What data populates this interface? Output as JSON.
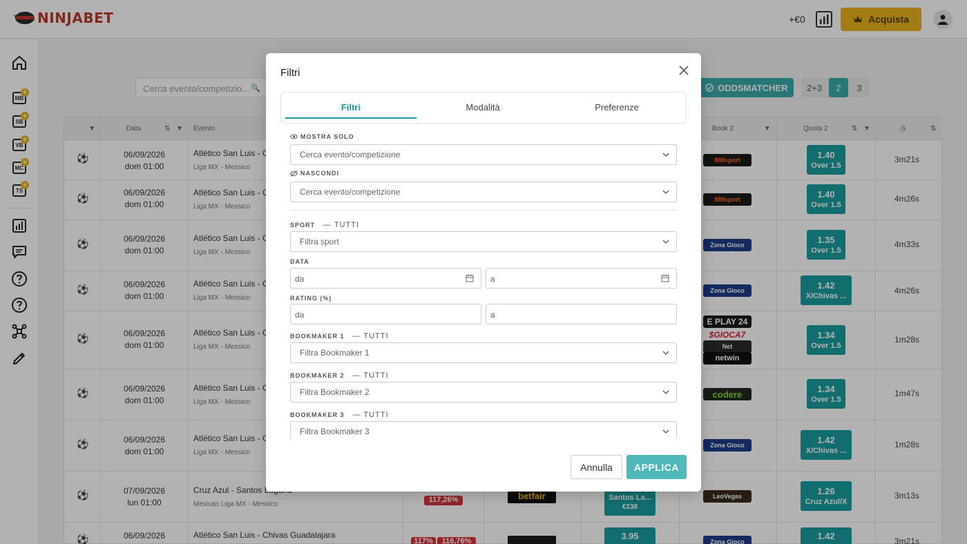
{
  "app": {
    "logo_text": "NINJABET"
  },
  "header": {
    "balance": "+€0",
    "buy_label": "Acquista"
  },
  "sidebar": {
    "tags": [
      "MB",
      "SB",
      "VB",
      "MC",
      "TS"
    ]
  },
  "toolbar": {
    "search_placeholder": "Cerca evento/competizio...",
    "oddsmatcher_label": "ODDSMATCHER",
    "modes": [
      "2+3",
      "2",
      "3"
    ],
    "active_mode": "2"
  },
  "table": {
    "headers": {
      "data": "Data",
      "evento": "Evento",
      "book2": "Book 2",
      "quota2": "Quota 2"
    },
    "rows": [
      {
        "date": "06/09/2026",
        "time": "dom 01:00",
        "event": "Atlético San Luis - Ch",
        "league": "Liga MX - Messico",
        "book2": "888sport",
        "q_val": "1.40",
        "q_lab": "Over 1.5",
        "elapsed": "3m21s"
      },
      {
        "date": "06/09/2026",
        "time": "dom 01:00",
        "event": "Atlético San Luis - Ch",
        "league": "Liga MX - Messico",
        "book2": "888sport",
        "q_val": "1.40",
        "q_lab": "Over 1.5",
        "elapsed": "4m26s"
      },
      {
        "date": "06/09/2026",
        "time": "dom 01:00",
        "event": "Atlético San Luis - Ch",
        "league": "Liga MX - Messico",
        "book2": "Zona Gioco",
        "q_val": "1.35",
        "q_lab": "Over 1.5",
        "elapsed": "4m33s"
      },
      {
        "date": "06/09/2026",
        "time": "dom 01:00",
        "event": "Atlético San Luis - Ch",
        "league": "Liga MX - Messico",
        "book2": "Zona Gioco",
        "q_val": "1.42",
        "q_lab": "X/Chivas ...",
        "elapsed": "4m26s"
      },
      {
        "date": "06/09/2026",
        "time": "dom 01:00",
        "event": "Atlético San Luis - Ch",
        "league": "Liga MX - Messico",
        "book2": "E PLAY 24",
        "q_val": "1.34",
        "q_lab": "Over 1.5",
        "elapsed": "1m28s"
      },
      {
        "date": "06/09/2026",
        "time": "dom 01:00",
        "event": "Atlético San Luis - Ch",
        "league": "Liga MX - Messico",
        "book2": "codere",
        "q_val": "1.34",
        "q_lab": "Over 1.5",
        "elapsed": "1m47s"
      },
      {
        "date": "06/09/2026",
        "time": "dom 01:00",
        "event": "Atlético San Luis - Ch",
        "league": "Liga MX - Messico",
        "book2": "Zona Gioco",
        "q_val": "1.42",
        "q_lab": "X/Chivas ...",
        "elapsed": "1m28s"
      },
      {
        "date": "07/09/2026",
        "time": "lun 01:00",
        "event": "Cruz Azul - Santos Laguna",
        "league": "Mexican Liga MX - Messico",
        "book2": "LeoVegas",
        "q_val": "1.26",
        "q_lab": "Cruz Azul/X",
        "elapsed": "3m13s",
        "rating1": "117,26%",
        "book1": "betfair",
        "q1_lab": "Santos La...",
        "q1_sub": "€238"
      },
      {
        "date": "06/09/2026",
        "time": "",
        "event": "Atlético San Luis - Chivas Guadalajara",
        "league": "",
        "book2": "Zona Gioco",
        "q_val": "1.42",
        "q_lab": "",
        "elapsed": "3m21s",
        "rating1": "117%",
        "rating2": "116,76%",
        "q1_val": "3.95"
      }
    ]
  },
  "modal": {
    "title": "Filtri",
    "tabs": [
      "Filtri",
      "Modalità",
      "Preferenze"
    ],
    "active_tab": "Filtri",
    "mostra_solo": {
      "label": "MOSTRA SOLO",
      "placeholder": "Cerca evento/competizione"
    },
    "nascondi": {
      "label": "NASCONDI",
      "placeholder": "Cerca evento/competizione"
    },
    "sport": {
      "label": "SPORT",
      "tutti": "— TUTTI",
      "placeholder": "Filtra sport"
    },
    "data": {
      "label": "DATA",
      "from": "da",
      "to": "a"
    },
    "rating": {
      "label": "RATING (%)",
      "from": "da",
      "to": "a"
    },
    "bookmaker1": {
      "label": "BOOKMAKER 1",
      "tutti": "— TUTTI",
      "placeholder": "Filtra Bookmaker 1"
    },
    "bookmaker2": {
      "label": "BOOKMAKER 2",
      "tutti": "— TUTTI",
      "placeholder": "Filtra Bookmaker 2"
    },
    "bookmaker3": {
      "label": "BOOKMAKER 3",
      "tutti": "— TUTTI",
      "placeholder": "Filtra Bookmaker 3"
    },
    "cancel_label": "Annulla",
    "apply_label": "APPLICA"
  },
  "colors": {
    "accent": "#1a9e9e",
    "gold": "#e8b21f",
    "brand_red": "#c0392b"
  }
}
